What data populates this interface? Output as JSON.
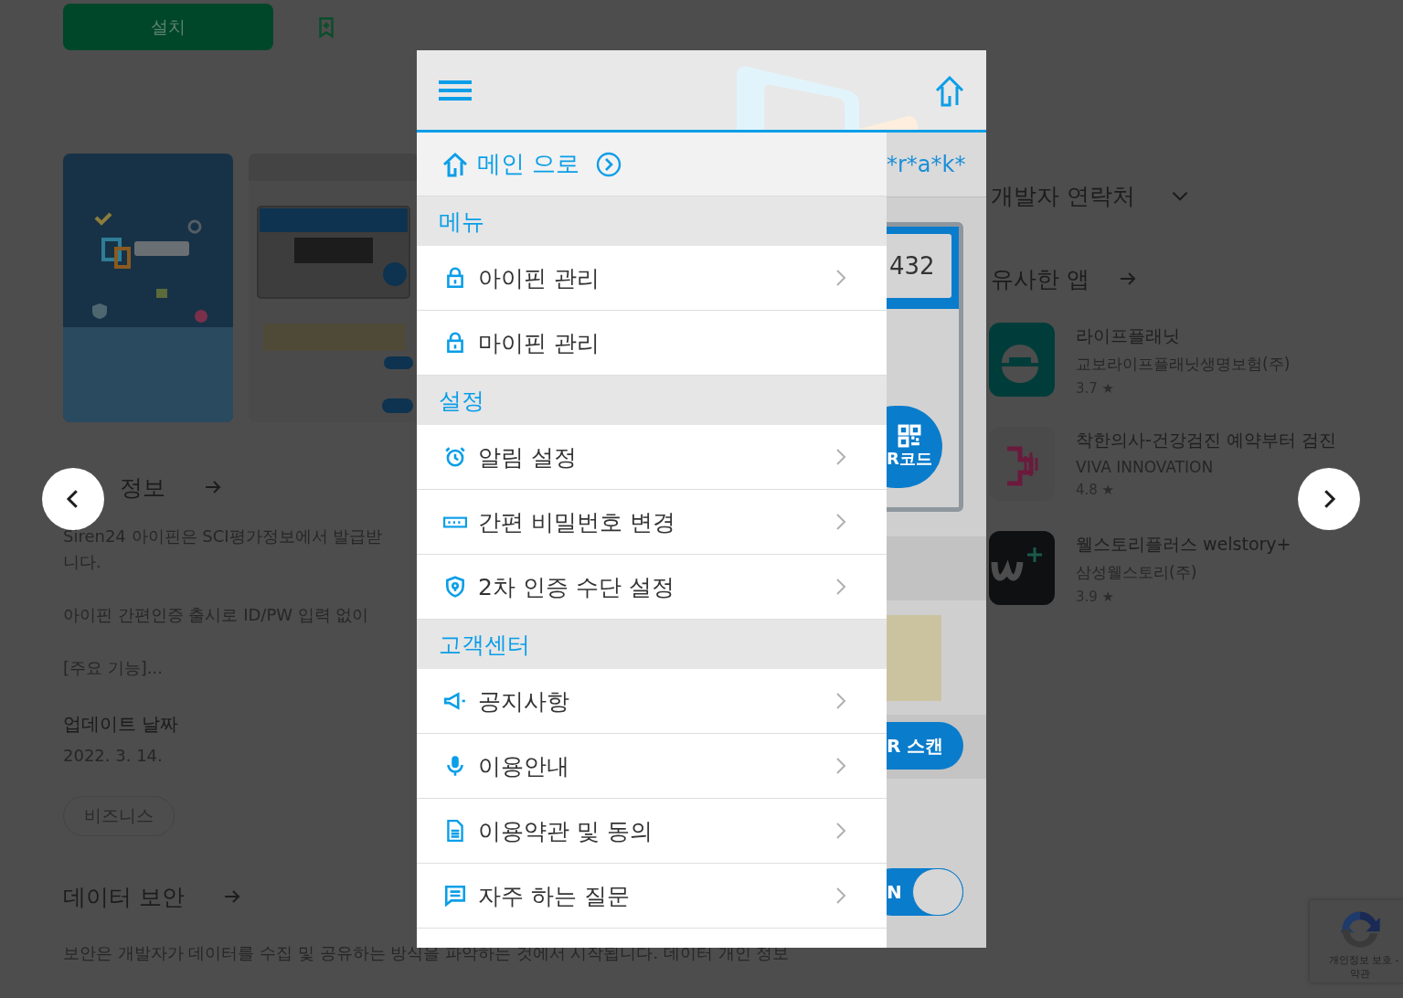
{
  "top": {
    "install": "설치"
  },
  "about": {
    "title": "정보",
    "lines": [
      "Siren24 아이핀은 SCI평가정보에서 발급받",
      "니다."
    ],
    "paragraphs": [
      "아이핀 간편인증 출시로 ID/PW 입력 없이",
      "[주요 기능]..."
    ],
    "update_label": "업데이트 날짜",
    "update_date": "2022. 3. 14.",
    "tag": "비즈니스"
  },
  "data_safety": {
    "title": "데이터 보안",
    "text": "보안은 개발자가 데이터를 수집 및 공유하는 방식을 파악하는 것에서 시작됩니다. 데이터 개인 정보"
  },
  "developer_contact": "개발자 연락처",
  "similar": {
    "title": "유사한 앱",
    "apps": [
      {
        "name": "라이프플래닛",
        "developer": "교보라이프플래닛생명보험(주)",
        "rating": "3.7 ★"
      },
      {
        "name": "착한의사-건강검진 예약부터 검진",
        "developer": "VIVA INNOVATION",
        "rating": "4.8 ★"
      },
      {
        "name": "웰스토리플러스 welstory+",
        "developer": "삼성웰스토리(주)",
        "rating": "3.9 ★"
      }
    ]
  },
  "lightbox": {
    "menu": {
      "home_link": "메인 으로",
      "entries": [
        {
          "kind": "header",
          "label": "메뉴"
        },
        {
          "kind": "item",
          "label": "아이핀 관리",
          "chevron": true
        },
        {
          "kind": "item",
          "label": "마이핀 관리",
          "chevron": false
        },
        {
          "kind": "header",
          "label": "설정"
        },
        {
          "kind": "item",
          "label": "알림 설정",
          "chevron": true
        },
        {
          "kind": "item",
          "label": "간편 비밀번호 변경",
          "chevron": true
        },
        {
          "kind": "item",
          "label": "2차 인증 수단 설정",
          "chevron": true
        },
        {
          "kind": "header",
          "label": "고객센터"
        },
        {
          "kind": "item",
          "label": "공지사항",
          "chevron": true
        },
        {
          "kind": "item",
          "label": "이용안내",
          "chevron": true
        },
        {
          "kind": "item",
          "label": "이용약관 및 동의",
          "chevron": true
        },
        {
          "kind": "item",
          "label": "자주 하는 질문",
          "chevron": true
        }
      ]
    },
    "behind": {
      "user_id": "*r*a*k*",
      "pin": "432",
      "qr_code": "R코드",
      "qr_scan": "R 스캔",
      "toggle": "N",
      "toggle_on": true
    }
  },
  "recaptcha": {
    "privacy": "개인정보 보호 -",
    "terms": "약관"
  }
}
